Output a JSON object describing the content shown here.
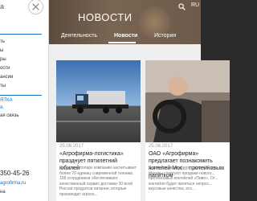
{
  "drawer": {
    "logo_text": "а",
    "top_line_text": "",
    "link_1": "ть",
    "link_2": "ы",
    "link_3": "ры",
    "link_4": "ости",
    "link_5": "ансии",
    "link_6": "ты",
    "banner_1": "ЯТКА",
    "banner_2": "я.",
    "banner_3": "ая связь",
    "phone": "350-45-26",
    "email": "agrofirma.ru",
    "bottom_label": "на"
  },
  "header": {
    "title": "НОВОСТИ",
    "lang": "RU",
    "tabs": [
      {
        "label": "Деятельность"
      },
      {
        "label": "Новости"
      },
      {
        "label": "История"
      }
    ]
  },
  "cards": [
    {
      "date": "25.08.2017",
      "title": "«Агрофирма-логистика» празднует пятилетний юбилей",
      "text": "Сегодня автопарк компании насчитывает более 70 единиц современной техники. 158 сотрудников обеспечивают качественный сервис доставки 30 всей России продуктов питания, которые производит агрохо..."
    },
    {
      "date": "25.08.2017",
      "title": "ОАО «Агрофирма» предлагает познакомить жителей Мос... протеиновым напитком",
      "text": "В декабре нынешнего года в г.20 р... Москвы стартуют продажи нового... протеиновых коктейлей «Пиво». От... коктейля будет являться непрос... вкусовые качества, его..."
    }
  ],
  "colors": {
    "accent_blue": "#1b6fc1",
    "header_brown": "#6e5a49"
  }
}
